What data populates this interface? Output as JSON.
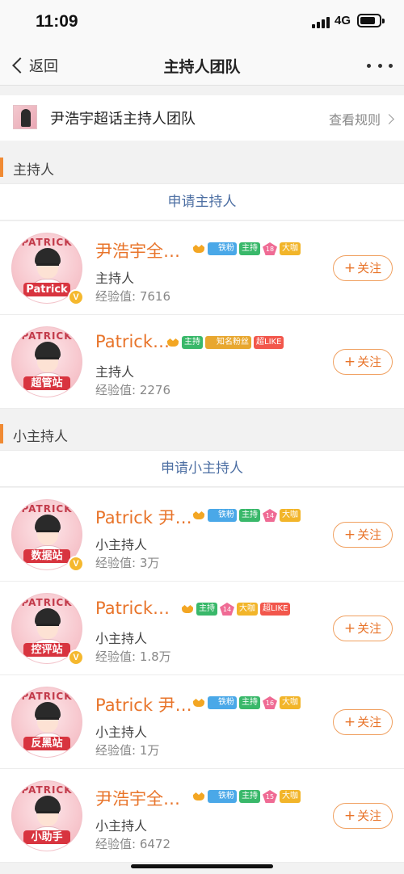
{
  "status_bar": {
    "time": "11:09",
    "network": "4G"
  },
  "nav": {
    "back_label": "返回",
    "title": "主持人团队"
  },
  "topic": {
    "name": "尹浩宇超话主持人团队",
    "rules_label": "查看规则"
  },
  "hosts_section": {
    "title": "主持人",
    "apply_label": "申请主持人",
    "members": [
      {
        "name": "尹浩宇全…",
        "role": "主持人",
        "exp_label": "经验值: 7616",
        "avatar_text": "Patrick",
        "verified": true,
        "badges": [
          "crown",
          "铁粉",
          "主持",
          "lvl:18",
          "大咖"
        ]
      },
      {
        "name": "Patrick…",
        "role": "主持人",
        "exp_label": "经验值: 2276",
        "avatar_text": "超管站",
        "verified": false,
        "badges": [
          "crown",
          "主持",
          "知名粉丝",
          "超LIKE"
        ]
      }
    ]
  },
  "sub_hosts_section": {
    "title": "小主持人",
    "apply_label": "申请小主持人",
    "members": [
      {
        "name": "Patrick 尹…",
        "role": "小主持人",
        "exp_label": "经验值: 3万",
        "avatar_text": "数据站",
        "verified": true,
        "badges": [
          "crown",
          "铁粉",
          "主持",
          "lvl:14",
          "大咖"
        ]
      },
      {
        "name": "Patrick…",
        "role": "小主持人",
        "exp_label": "经验值: 1.8万",
        "avatar_text": "控评站",
        "verified": true,
        "badges": [
          "crown",
          "主持",
          "lvl:14",
          "大咖",
          "超LIKE"
        ]
      },
      {
        "name": "Patrick 尹…",
        "role": "小主持人",
        "exp_label": "经验值: 1万",
        "avatar_text": "反黑站",
        "verified": false,
        "badges": [
          "crown",
          "铁粉",
          "主持",
          "lvl:16",
          "大咖"
        ]
      },
      {
        "name": "尹浩宇全…",
        "role": "小主持人",
        "exp_label": "经验值: 6472",
        "avatar_text": "小助手",
        "verified": false,
        "badges": [
          "crown",
          "铁粉",
          "主持",
          "lvl:15",
          "大咖"
        ]
      }
    ]
  },
  "follow_label": "关注",
  "follow_plus": "+",
  "avatar_arc": "PATRICK",
  "verified_mark": "V",
  "colors": {
    "accent": "#e8742a",
    "link": "#4d6fa3",
    "section_bar": "#f08a33"
  }
}
